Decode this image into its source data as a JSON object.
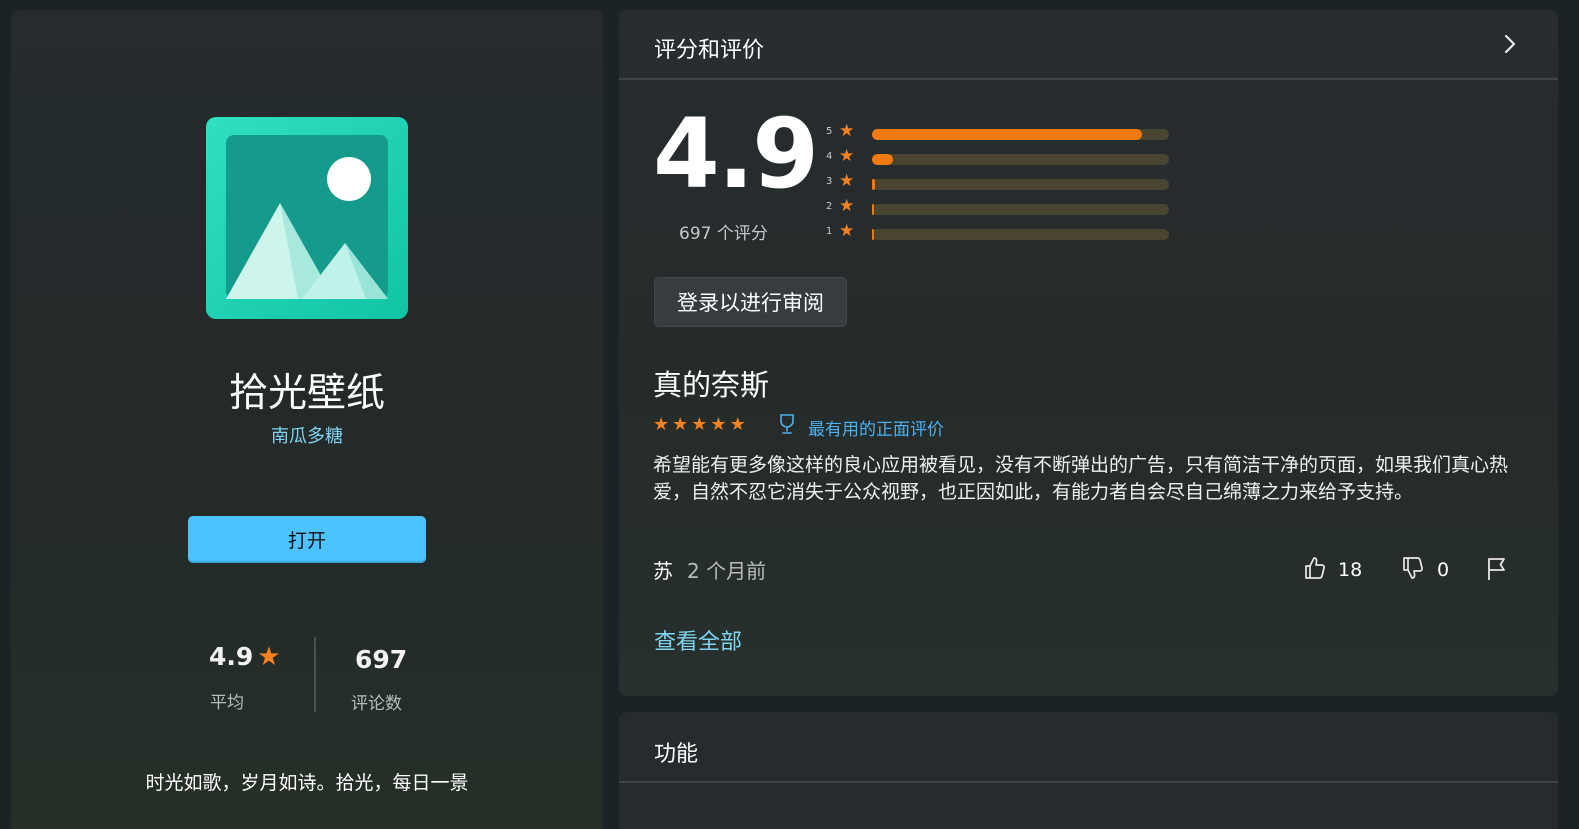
{
  "app": {
    "name": "拾光壁纸",
    "publisher": "南瓜多糖",
    "open_label": "打开",
    "tagline": "时光如歌，岁月如诗。拾光，每日一景",
    "average_value": "4.9",
    "average_label": "平均",
    "review_count_value": "697",
    "review_count_label": "评论数"
  },
  "ratings": {
    "section_title": "评分和评价",
    "score": "4.9",
    "count_text": "697 个评分",
    "bars": [
      {
        "stars": "5",
        "fraction": 0.91
      },
      {
        "stars": "4",
        "fraction": 0.07
      },
      {
        "stars": "3",
        "fraction": 0.01
      },
      {
        "stars": "2",
        "fraction": 0.005
      },
      {
        "stars": "1",
        "fraction": 0.005
      }
    ],
    "signin_label": "登录以进行审阅",
    "see_all": "查看全部"
  },
  "review": {
    "title": "真的奈斯",
    "stars": 5,
    "badge": "最有用的正面评价",
    "body": "希望能有更多像这样的良心应用被看见，没有不断弹出的广告，只有简洁干净的页面，如果我们真心热爱，自然不忍它消失于公众视野，也正因如此，有能力者自会尽自己绵薄之力来给予支持。",
    "author": "苏",
    "date": "2 个月前",
    "helpful": "18",
    "unhelpful": "0"
  },
  "features": {
    "section_title": "功能"
  },
  "colors": {
    "accent": "#4cc2ff",
    "star": "#f58220",
    "link": "#7fd4f2"
  }
}
